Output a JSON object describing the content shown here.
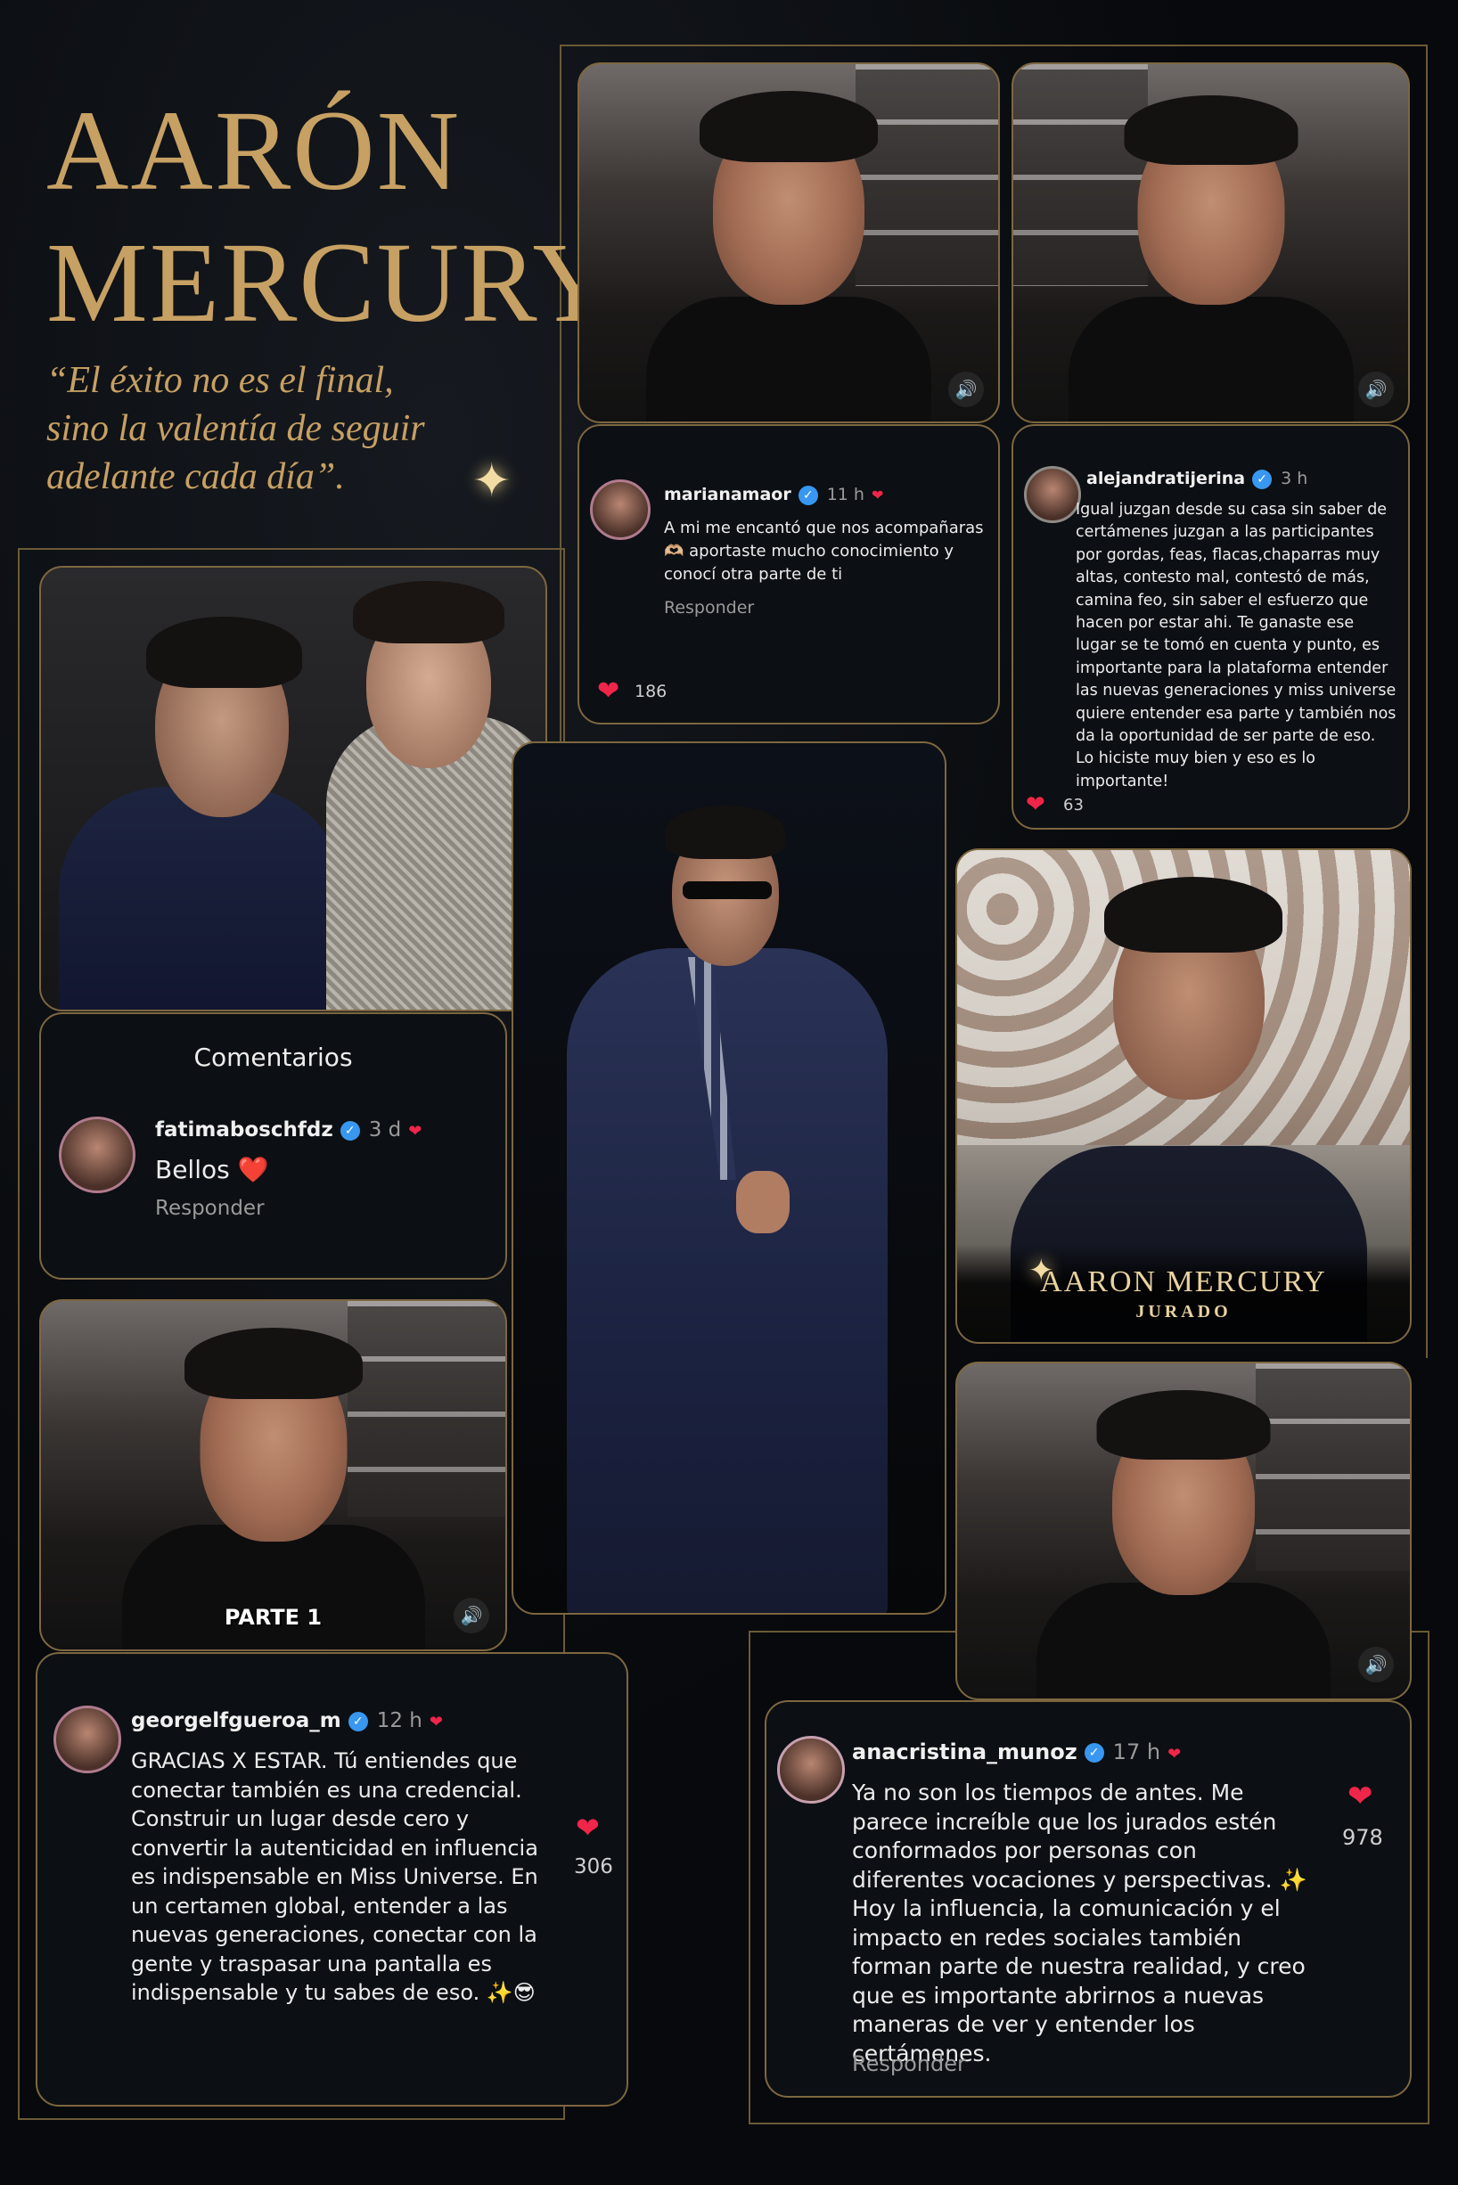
{
  "header": {
    "title_line1": "AARÓN",
    "title_line2": "MERCURY",
    "quote_line1": "“El éxito no es el final,",
    "quote_line2": "sino la valentía de seguir",
    "quote_line3": "adelante cada día”."
  },
  "comments": {
    "marianamaor": {
      "user": "marianamaor",
      "time": "11 h",
      "text": "A mi me encantó que nos acompañaras 🫶🏼 aportaste mucho conocimiento y conocí otra parte de ti",
      "reply": "Responder",
      "likes": "186"
    },
    "alejandratijerina": {
      "user": "alejandratijerina",
      "time": "3 h",
      "text": "Igual juzgan desde su casa sin saber de certámenes juzgan a las participantes por gordas, feas, flacas,chaparras muy altas, contesto mal, contestó de más, camina feo, sin saber el esfuerzo que hacen por estar ahi. Te ganaste ese lugar se te tomó en cuenta y punto, es importante para la plataforma entender las nuevas generaciones y miss universe quiere entender esa parte y también nos da la oportunidad de ser parte de eso. Lo hiciste muy bien y eso es lo importante!",
      "likes": "63"
    },
    "fatimaboschfdz": {
      "header": "Comentarios",
      "user": "fatimaboschfdz",
      "time": "3 d",
      "text": "Bellos ❤️",
      "reply": "Responder"
    },
    "georgelfgueroa_m": {
      "user": "georgelfgueroa_m",
      "time": "12 h",
      "text": "GRACIAS X ESTAR. Tú entiendes que conectar también es una credencial. Construir un lugar desde cero y convertir la autenticidad en influencia es indispensable en Miss Universe. En un certamen global, entender a las nuevas generaciones, conectar con la gente y traspasar una pantalla es indispensable y tu sabes de eso. ✨😎",
      "likes": "306"
    },
    "anacristina_munoz": {
      "user": "anacristina_munoz",
      "time": "17 h",
      "text": "Ya no son los tiempos de antes. Me parece increíble que los jurados estén conformados por personas con diferentes vocaciones y perspectivas. ✨ Hoy la influencia, la comunicación y el impacto en redes sociales también forman parte de nuestra realidad, y creo que es importante abrirnos a nuevas maneras de ver y entender los certámenes.",
      "reply": "Responder",
      "likes": "978"
    }
  },
  "video_overlay": {
    "part_label": "PARTE 1"
  },
  "jurado_card": {
    "name": "AARON MERCURY",
    "role": "JURADO"
  },
  "icons": {
    "verified": "verified-badge-icon",
    "heart": "heart-icon",
    "speaker": "speaker-icon",
    "sparkle": "sparkle-icon"
  },
  "colors": {
    "gold": "#c7a063",
    "heart": "#f0254a",
    "verified": "#3897f0",
    "background": "#07090c"
  }
}
